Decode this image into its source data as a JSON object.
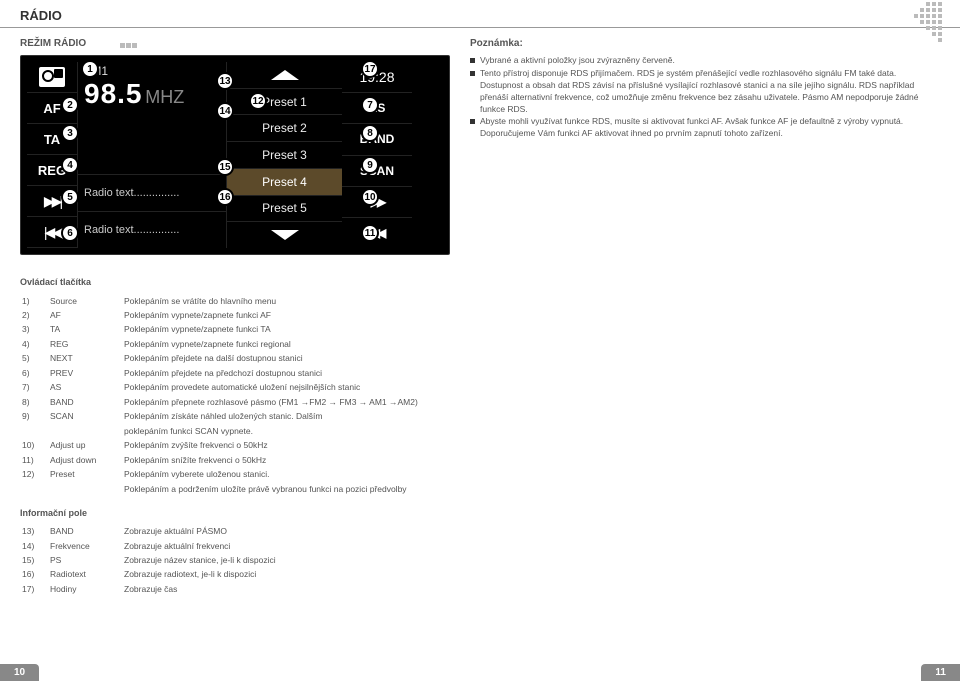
{
  "header": {
    "title": "RÁDIO",
    "subtitle": "REŽIM RÁDIO"
  },
  "radio": {
    "band": "FM1",
    "freq": "98.5",
    "unit": "MHZ",
    "clock": "19:28",
    "af": "AF",
    "ta": "TA",
    "reg": "REG",
    "rt1": "Radio text...............",
    "rt2": "Radio text...............",
    "as": "AS",
    "bandbtn": "BAND",
    "scan": "SCAN",
    "presets": [
      "Preset 1",
      "Preset 2",
      "Preset 3",
      "Preset 4",
      "Preset 5"
    ]
  },
  "markers": [
    "1",
    "2",
    "3",
    "4",
    "5",
    "6",
    "7",
    "8",
    "9",
    "10",
    "11",
    "12",
    "13",
    "14",
    "15",
    "16",
    "17"
  ],
  "note_title": "Poznámka:",
  "notes": [
    "Vybrané a aktivní položky jsou zvýrazněny červeně.",
    "Tento přístroj disponuje RDS přijímačem. RDS je systém přenášející vedle rozhlasového signálu FM také data. Dostupnost a obsah dat RDS závisí na příslušné vysílající rozhlasové stanici a na síle jejího signálu. RDS například přenáší alternativní frekvence, což umožňuje změnu frekvence bez zásahu uživatele. Pásmo AM nepodporuje žádné funkce RDS.",
    "Abyste mohli využívat funkce RDS, musíte si aktivovat funkci AF. Avšak funkce AF je defaultně z výroby vypnutá. Doporučujeme Vám funkci AF aktivovat ihned po prvním zapnutí tohoto zařízení."
  ],
  "ctrl_title": "Ovládací tlačítka",
  "controls": [
    {
      "n": "1)",
      "k": "Source",
      "v": "Poklepáním se vrátíte do hlavního menu"
    },
    {
      "n": "2)",
      "k": "AF",
      "v": "Poklepáním vypnete/zapnete funkci AF"
    },
    {
      "n": "3)",
      "k": "TA",
      "v": "Poklepáním vypnete/zapnete funkci TA"
    },
    {
      "n": "4)",
      "k": "REG",
      "v": "Poklepáním vypnete/zapnete funkci regional"
    },
    {
      "n": "5)",
      "k": "NEXT",
      "v": "Poklepáním přejdete na další dostupnou stanici"
    },
    {
      "n": "6)",
      "k": "PREV",
      "v": "Poklepáním přejdete na předchozí dostupnou stanici"
    },
    {
      "n": "7)",
      "k": "AS",
      "v": "Poklepáním provedete automatické uložení nejsilnějších stanic"
    },
    {
      "n": "8)",
      "k": "BAND",
      "v": "Poklepáním přepnete rozhlasové pásmo (FM1 →FM2 → FM3 → AM1 →AM2)"
    },
    {
      "n": "9)",
      "k": "SCAN",
      "v": "Poklepáním získáte náhled uložených stanic. Dalším"
    },
    {
      "n": "",
      "k": "",
      "v": "poklepáním funkci SCAN vypnete."
    },
    {
      "n": "10)",
      "k": "Adjust up",
      "v": "Poklepáním zvýšíte frekvenci o 50kHz"
    },
    {
      "n": "11)",
      "k": "Adjust down",
      "v": "Poklepáním snížíte frekvenci o 50kHz"
    },
    {
      "n": "12)",
      "k": "Preset",
      "v": "Poklepáním vyberete uloženou stanici."
    },
    {
      "n": "",
      "k": "",
      "v": "Poklepáním a podržením uložíte právě vybranou funkci na pozici předvolby"
    }
  ],
  "info_title": "Informační pole",
  "info": [
    {
      "n": "13)",
      "k": "BAND",
      "v": "Zobrazuje aktuální PÁSMO"
    },
    {
      "n": "14)",
      "k": "Frekvence",
      "v": "Zobrazuje aktuální frekvenci"
    },
    {
      "n": "15)",
      "k": "PS",
      "v": "Zobrazuje název stanice, je-li k dispozici"
    },
    {
      "n": "16)",
      "k": "Radiotext",
      "v": "Zobrazuje radiotext, je-li k dispozici"
    },
    {
      "n": "17)",
      "k": "Hodiny",
      "v": "Zobrazuje čas"
    }
  ],
  "page_left": "10",
  "page_right": "11"
}
